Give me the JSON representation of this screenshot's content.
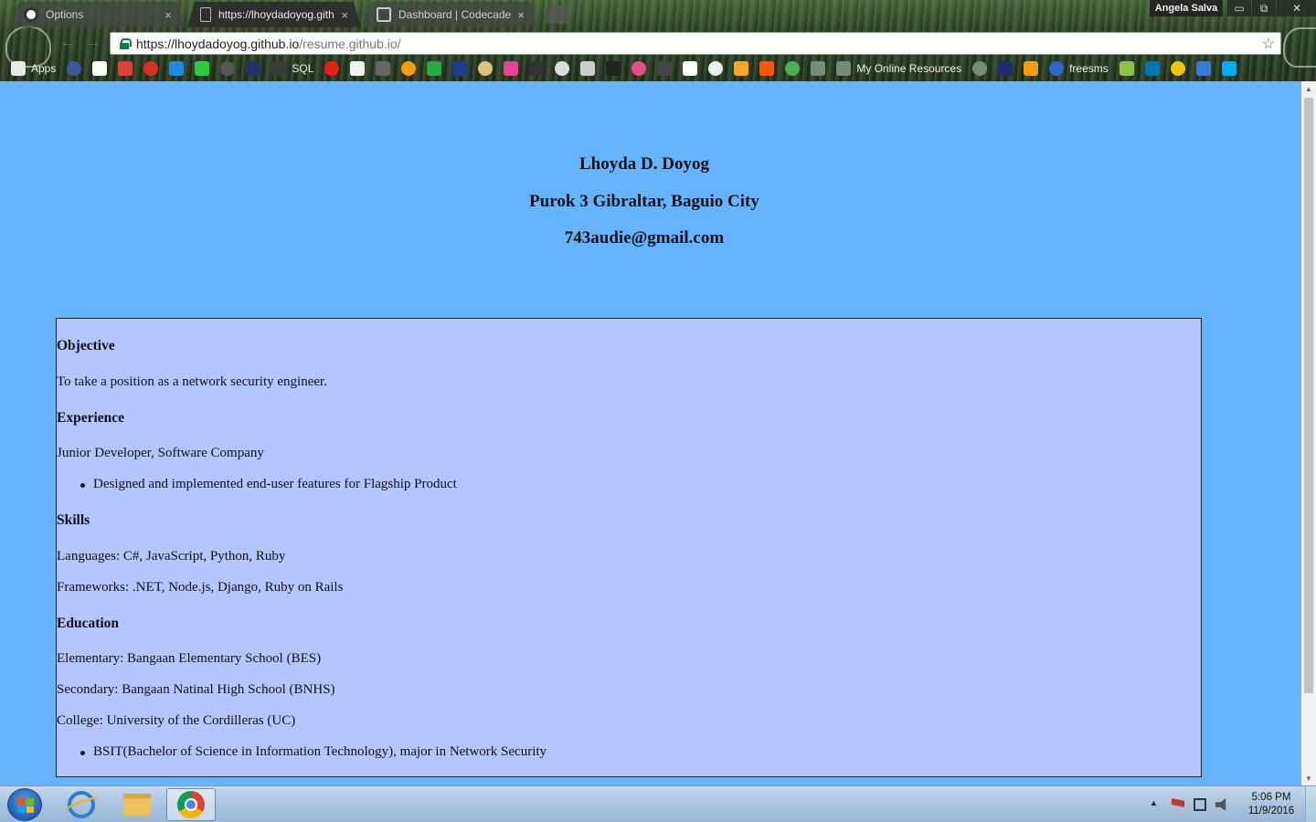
{
  "browser": {
    "tabs": [
      {
        "title": "Options",
        "close": "×",
        "icon_color": "#ffffff"
      },
      {
        "title": "https://lhoydadoyog.gith",
        "close": "×",
        "icon_color": "#bbbbbb"
      },
      {
        "title": "Dashboard | Codecadem",
        "close": "×",
        "icon_color": "#cccccc"
      }
    ],
    "profile_name": "Angela Salva",
    "window_controls": {
      "minimize": "▭",
      "restore": "⧉",
      "close": "✕"
    },
    "url_host": "https://lhoydadoyog.github.io",
    "url_path": "/resume.github.io/",
    "bookmark_star": "☆",
    "nav": {
      "back": "←",
      "forward": "→",
      "reload": "↻"
    },
    "bookmarks": [
      {
        "label": "Apps",
        "color": "#e8e8e8"
      },
      {
        "label": "",
        "color": "#3b5998"
      },
      {
        "label": "",
        "color": "#ffffff"
      },
      {
        "label": "",
        "color": "#db4437"
      },
      {
        "label": "",
        "color": "#d93025"
      },
      {
        "label": "",
        "color": "#1e88e5"
      },
      {
        "label": "",
        "color": "#2ecc40"
      },
      {
        "label": "",
        "color": "#555555"
      },
      {
        "label": "",
        "color": "#223366"
      },
      {
        "label": "SQL",
        "color": "#3a3a3a"
      },
      {
        "label": "",
        "color": "#e62117"
      },
      {
        "label": "",
        "color": "#f2f2f2"
      },
      {
        "label": "",
        "color": "#666666"
      },
      {
        "label": "",
        "color": "#f39c12"
      },
      {
        "label": "",
        "color": "#28a745"
      },
      {
        "label": "",
        "color": "#1d3d8f"
      },
      {
        "label": "",
        "color": "#e0c080"
      },
      {
        "label": "",
        "color": "#e84393"
      },
      {
        "label": "",
        "color": "#333333"
      },
      {
        "label": "",
        "color": "#dddddd"
      },
      {
        "label": "",
        "color": "#cccccc"
      },
      {
        "label": "",
        "color": "#222222"
      },
      {
        "label": "",
        "color": "#e84e8a"
      },
      {
        "label": "",
        "color": "#444444"
      },
      {
        "label": "",
        "color": "#ffffff"
      },
      {
        "label": "",
        "color": "#eeeeee"
      },
      {
        "label": "",
        "color": "#f5a623"
      },
      {
        "label": "",
        "color": "#ff5500"
      },
      {
        "label": "",
        "color": "#4caf50"
      },
      {
        "label": "",
        "color": "#7a8a7a"
      },
      {
        "label": "My Online Resources",
        "color": "#7a8a7a"
      },
      {
        "label": "",
        "color": "#7a8a7a"
      },
      {
        "label": "",
        "color": "#1d2d6f"
      },
      {
        "label": "",
        "color": "#f39c12"
      },
      {
        "label": "freesms",
        "color": "#3366cc"
      },
      {
        "label": "",
        "color": "#8bc34a"
      },
      {
        "label": "",
        "color": "#0077b5"
      },
      {
        "label": "",
        "color": "#f4c20d"
      },
      {
        "label": "",
        "color": "#3a7bd5"
      },
      {
        "label": "",
        "color": "#00aaff"
      }
    ]
  },
  "page": {
    "name": "Lhoyda D. Doyog",
    "address": "Purok 3 Gibraltar, Baguio City",
    "email": "743audie@gmail.com",
    "objective_title": "Objective",
    "objective_text": "To take a position as a network security engineer.",
    "experience_title": "Experience",
    "experience_role": "Junior Developer, Software Company",
    "experience_bullet": "Designed and implemented end-user features for Flagship Product",
    "skills_title": "Skills",
    "skills_languages": "Languages: C#, JavaScript, Python, Ruby",
    "skills_frameworks": "Frameworks: .NET, Node.js, Django, Ruby on Rails",
    "education_title": "Education",
    "education_elementary": "Elementary: Bangaan Elementary School (BES)",
    "education_secondary": "Secondary: Bangaan Natinal High School (BNHS)",
    "education_college": "College: University of the Cordilleras (UC)",
    "education_bullet": "BSIT(Bachelor of Science in Information Technology), major in Network Security",
    "background_color": "#66b3ff",
    "box_color": "#b3c6ff"
  },
  "taskbar": {
    "clock_time": "5:06 PM",
    "clock_date": "11/9/2016",
    "tray_arrow": "▲"
  }
}
